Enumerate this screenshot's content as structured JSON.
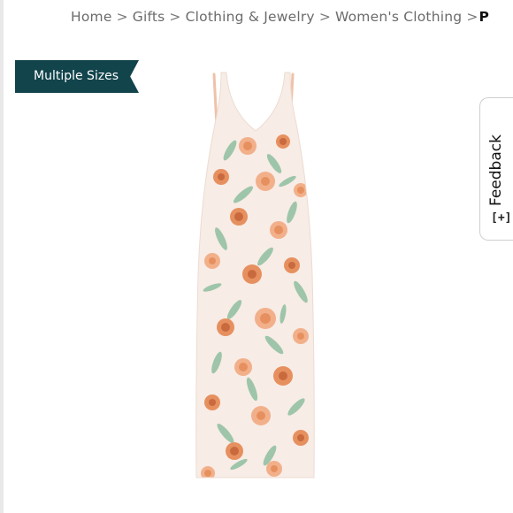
{
  "breadcrumb": {
    "items": [
      {
        "label": "Home"
      },
      {
        "label": "Gifts"
      },
      {
        "label": "Clothing & Jewelry"
      },
      {
        "label": "Women's Clothing"
      }
    ],
    "separator": ">",
    "current": "P"
  },
  "badge": {
    "label": "Multiple Sizes",
    "color": "#12444c"
  },
  "product": {
    "image_icon": "floral-slip-dress-image",
    "colors": {
      "fabric": "#f7ece6",
      "flower_orange": "#e7905f",
      "flower_peach": "#f2b08a",
      "leaf_green": "#8fbf9f"
    }
  },
  "feedback": {
    "label": "Feedback",
    "icon_text": "[+]"
  }
}
